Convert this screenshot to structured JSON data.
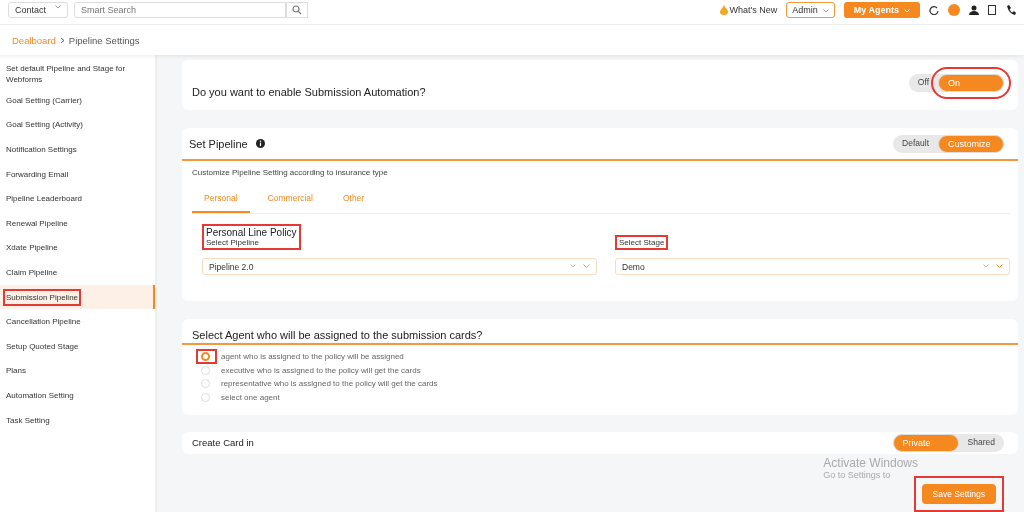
{
  "topbar": {
    "entity_select": "Contact",
    "search": {
      "placeholder": "Smart Search"
    },
    "whats_new": "What's New",
    "role_select": "Admin",
    "agents_button": "My Agents"
  },
  "breadcrumb": [
    {
      "label": "Dealboard",
      "kind": "link"
    },
    {
      "label": "Pipeline Settings",
      "kind": "current"
    }
  ],
  "sidebar": {
    "items": [
      {
        "label": "Set default Pipeline and Stage for Webforms",
        "selected": false,
        "annotated": false
      },
      {
        "label": "Goal Setting (Carrier)",
        "selected": false,
        "annotated": false
      },
      {
        "label": "Goal Setting (Activity)",
        "selected": false,
        "annotated": false
      },
      {
        "label": "Notification Settings",
        "selected": false,
        "annotated": false
      },
      {
        "label": "Forwarding Email",
        "selected": false,
        "annotated": false
      },
      {
        "label": "Pipeline Leaderboard",
        "selected": false,
        "annotated": false
      },
      {
        "label": "Renewal Pipeline",
        "selected": false,
        "annotated": false
      },
      {
        "label": "Xdate Pipeline",
        "selected": false,
        "annotated": false
      },
      {
        "label": "Claim Pipeline",
        "selected": false,
        "annotated": false
      },
      {
        "label": "Submission Pipeline",
        "selected": true,
        "annotated": true
      },
      {
        "label": "Cancellation Pipeline",
        "selected": false,
        "annotated": false
      },
      {
        "label": "Setup Quoted Stage",
        "selected": false,
        "annotated": false
      },
      {
        "label": "Plans",
        "selected": false,
        "annotated": false
      },
      {
        "label": "Automation Setting",
        "selected": false,
        "annotated": false
      },
      {
        "label": "Task Setting",
        "selected": false,
        "annotated": false
      }
    ]
  },
  "automation": {
    "question": "Do you want to enable Submission Automation?",
    "options": [
      {
        "label": "Off",
        "selected": false,
        "annotated": false
      },
      {
        "label": "On",
        "selected": true,
        "annotated": true
      }
    ]
  },
  "set_pipeline": {
    "title": "Set Pipeline",
    "modes": [
      {
        "label": "Default",
        "selected": false
      },
      {
        "label": "Customize",
        "selected": true
      }
    ],
    "description": "Customize Pipeline Setting according to insurance type",
    "tabs": [
      {
        "label": "Personal",
        "selected": true
      },
      {
        "label": "Commercial",
        "selected": false
      },
      {
        "label": "Other",
        "selected": false
      }
    ],
    "policy_title": "Personal Line Policy",
    "policy_annotated": true,
    "fields": [
      {
        "label": "Select Pipeline",
        "value": "Pipeline 2.0"
      },
      {
        "label": "Select Stage",
        "value": "Demo",
        "annotated": true
      }
    ]
  },
  "agent": {
    "question": "Select Agent who will be assigned to the submission cards?",
    "options": [
      {
        "label": "agent who is assigned to the policy will be assigned",
        "selected": true,
        "annotated": true
      },
      {
        "label": "executive who is assigned to the policy will get the cards",
        "selected": false,
        "annotated": false
      },
      {
        "label": "representative who is assigned to the policy will get the cards",
        "selected": false,
        "annotated": false
      },
      {
        "label": "select one agent",
        "selected": false,
        "annotated": false
      }
    ]
  },
  "create_card": {
    "label": "Create Card in",
    "options": [
      {
        "label": "Private",
        "selected": true
      },
      {
        "label": "Shared",
        "selected": false
      }
    ]
  },
  "activation_notice": {
    "title": "Activate Windows",
    "subtitle": "Go to Settings to"
  },
  "save_button": {
    "label": "Save Settings",
    "annotated": true
  }
}
